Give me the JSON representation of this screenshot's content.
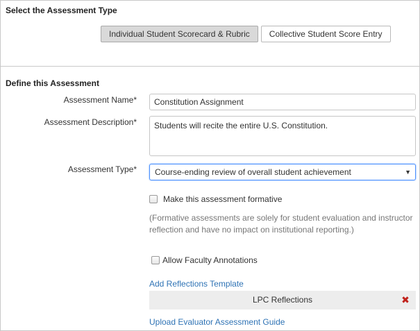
{
  "assessment_type_section": {
    "title": "Select the Assessment Type",
    "options": [
      {
        "label": "Individual Student Scorecard & Rubric",
        "selected": true
      },
      {
        "label": "Collective Student Score Entry",
        "selected": false
      }
    ]
  },
  "define_section": {
    "title": "Define this Assessment",
    "name_label": "Assessment Name*",
    "name_value": "Constitution Assignment",
    "description_label": "Assessment Description*",
    "description_value": "Students will recite the entire U.S. Constitution.",
    "type_label": "Assessment Type*",
    "type_value": "Course-ending review of overall student achievement",
    "formative_label": "Make this assessment formative",
    "formative_checked": false,
    "formative_note": "(Formative assessments are solely for student evaluation and instructor reflection and have no impact on institutional reporting.)",
    "annotations_label": "Allow Faculty Annotations",
    "annotations_checked": false,
    "add_reflections_link": "Add Reflections Template",
    "reflection_template_name": "LPC Reflections",
    "upload_guide_link": "Upload Evaluator Assessment Guide"
  },
  "colors": {
    "link": "#2f73b5",
    "remove_icon": "#c0211b",
    "focus_border": "#4d90fe"
  },
  "icons": {
    "select_arrow": "caret-down-icon",
    "remove": "close-icon"
  }
}
